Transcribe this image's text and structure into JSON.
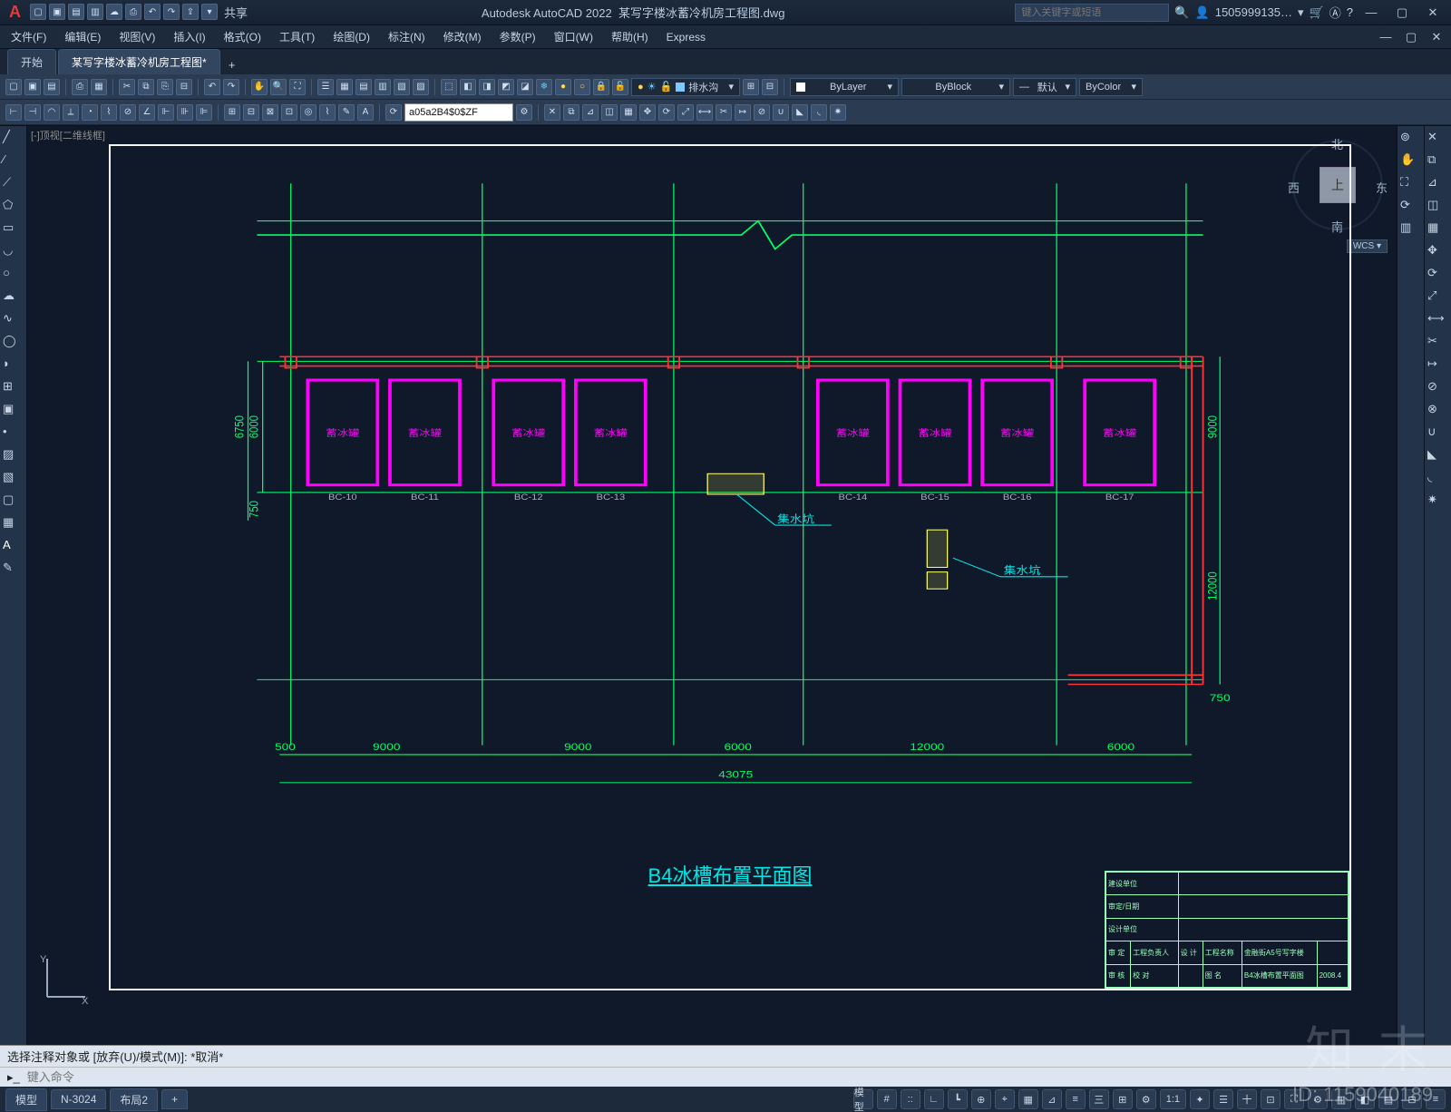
{
  "app": {
    "title_left": "Autodesk AutoCAD 2022",
    "title_doc": "某写字楼冰蓄冷机房工程图.dwg",
    "share": "共享",
    "search_ph": "键入关键字或短语",
    "user": "1505999135…",
    "logo": "A"
  },
  "menu": [
    "文件(F)",
    "编辑(E)",
    "视图(V)",
    "插入(I)",
    "格式(O)",
    "工具(T)",
    "绘图(D)",
    "标注(N)",
    "修改(M)",
    "参数(P)",
    "窗口(W)",
    "帮助(H)",
    "Express"
  ],
  "tabs": {
    "start": "开始",
    "doc": "某写字楼冰蓄冷机房工程图*",
    "plus": "+"
  },
  "layer": {
    "current": "排水沟",
    "droptag": "▾"
  },
  "props": {
    "bylayer": "ByLayer",
    "byblock": "ByBlock",
    "default": "默认",
    "bycolor": "ByColor"
  },
  "cmdbox": "a05a2B4$0$ZF",
  "nav": {
    "top": "上",
    "n": "北",
    "s": "南",
    "e": "东",
    "w": "西",
    "wcs": "WCS ▾"
  },
  "drawing": {
    "title": "B4冰槽布置平面图",
    "hint": "[-]顶视[二维线框]",
    "slots_left": [
      "蓄冰罐",
      "蓄冰罐",
      "蓄冰罐",
      "蓄冰罐"
    ],
    "slots_right": [
      "蓄冰罐",
      "蓄冰罐",
      "蓄冰罐",
      "蓄冰罐"
    ],
    "sub_left": [
      "BC-10",
      "BC-11",
      "BC-12",
      "BC-13"
    ],
    "sub_right": [
      "BC-14",
      "BC-15",
      "BC-16",
      "BC-17"
    ],
    "notes": [
      "集水坑",
      "集水坑"
    ],
    "dims_bottom": [
      "500",
      "9000",
      "9000",
      "6000",
      "12000",
      "6000"
    ],
    "dim_total": "43075",
    "dim_left1": "6750",
    "dim_left2": "6000",
    "dim_left3": "750",
    "dim_right1": "9000",
    "dim_right2": "12000",
    "dim_right3": "750"
  },
  "titleblock": {
    "r1": "建设单位",
    "r2": "审定/日期",
    "r3": "设计单位",
    "r4a": "审 定",
    "r4b": "工程负责人",
    "r4c": "设 计",
    "r4d": "工程名称",
    "r4e": "金融街A5号写字楼",
    "r5a": "审 核",
    "r5b": "校 对",
    "r5c": "图 名",
    "r5d": "B4冰槽布置平面图",
    "date": "2008.4"
  },
  "cmd": {
    "hist": "选择注释对象或 [放弃(U)/模式(M)]: *取消*",
    "prompt": "键入命令",
    "icon": "▸_"
  },
  "status": {
    "tabs": [
      "模型",
      "N-3024",
      "布局2",
      "+"
    ],
    "right": [
      "模型",
      "#",
      "::",
      "∟",
      "┗",
      "⊕",
      "⌖",
      "▦",
      "⊿",
      "≡",
      "三",
      "⊞",
      "⚙",
      "1:1",
      "✦",
      "☰",
      "十",
      "⊡",
      "⛶",
      "⚙",
      "▥",
      "◧",
      "▤",
      "⊟",
      "≡"
    ]
  },
  "wm": {
    "brand": "知 末",
    "id": "ID: 1159040189"
  }
}
